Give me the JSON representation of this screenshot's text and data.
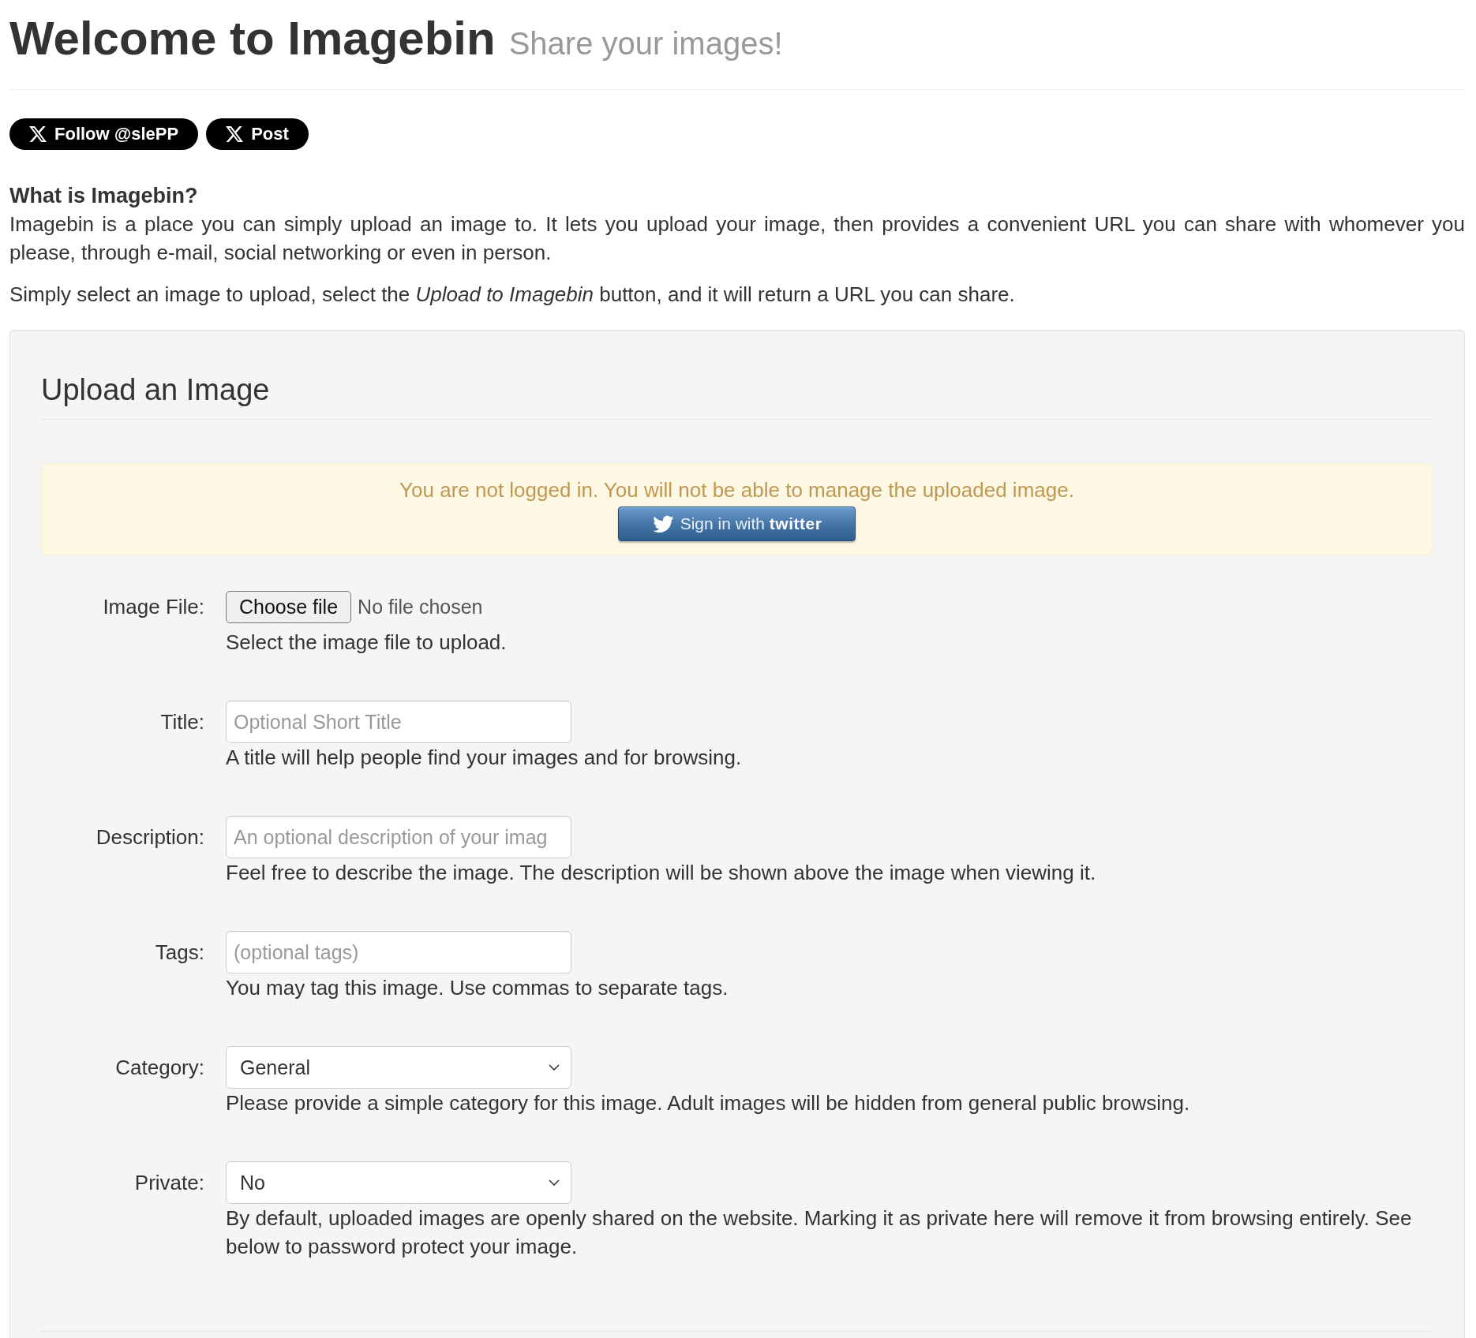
{
  "header": {
    "title": "Welcome to Imagebin",
    "subtitle": "Share your images!"
  },
  "social_buttons": [
    {
      "label": "Follow @slePP"
    },
    {
      "label": "Post"
    }
  ],
  "intro": {
    "heading": "What is Imagebin?",
    "paragraphs": [
      "Imagebin is a place you can simply upload an image to. It lets you upload your image, then provides a convenient URL you can share with whomever you please, through e-mail, social networking or even in person.",
      "Simply select an image to upload, select the *Upload to Imagebin* button, and it will return a URL you can share."
    ]
  },
  "upload_form": {
    "legend": "Upload an Image",
    "alert": {
      "message": "You are not logged in. You will not be able to manage the uploaded image.",
      "sign_in_button": "Sign in with **twitter**"
    },
    "fields": [
      {
        "kind": "file",
        "label": "Image File:",
        "button": "Choose file",
        "status": "No file chosen",
        "help": "Select the image file to upload."
      },
      {
        "kind": "text",
        "label": "Title:",
        "placeholder": "Optional Short Title",
        "help": "A title will help people find your images and for browsing."
      },
      {
        "kind": "text",
        "label": "Description:",
        "placeholder": "An optional description of your imag",
        "help": "Feel free to describe the image. The description will be shown above the image when viewing it."
      },
      {
        "kind": "text",
        "label": "Tags:",
        "placeholder": "(optional tags)",
        "help": "You may tag this image. Use commas to separate tags."
      },
      {
        "kind": "select",
        "label": "Category:",
        "value": "General",
        "help": "Please provide a simple category for this image. Adult images will be hidden from general public browsing."
      },
      {
        "kind": "select",
        "label": "Private:",
        "value": "No",
        "help": "By default, uploaded images are openly shared on the website. Marking it as private here will remove it from browsing entirely. See below to password protect your image."
      }
    ]
  }
}
